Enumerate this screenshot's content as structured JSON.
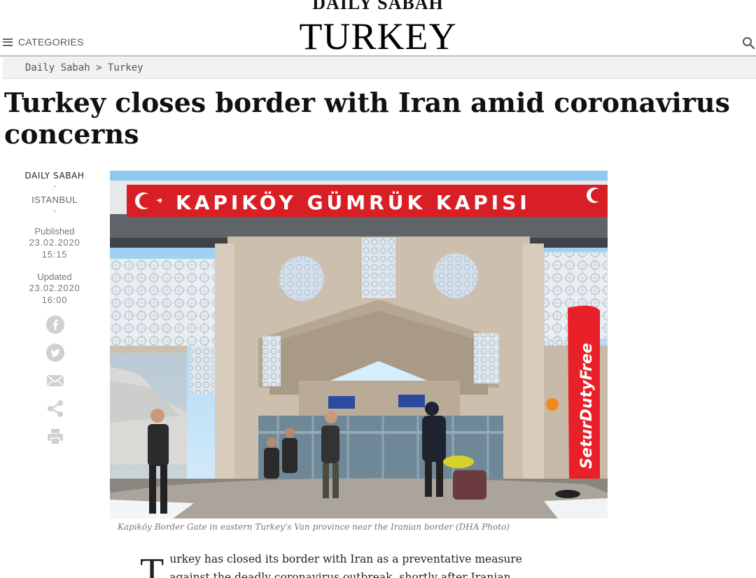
{
  "header": {
    "brand": "DAILY SABAH",
    "section": "TURKEY",
    "menu_label": "CATEGORIES",
    "menu_icon": "hamburger-icon",
    "search_icon": "search-icon"
  },
  "breadcrumb": "Daily Sabah > Turkey",
  "article": {
    "title": "Turkey closes border with Iran amid coronavirus concerns",
    "author": "DAILY SABAH",
    "dot1": "•",
    "location": "ISTANBUL",
    "dot2": "•",
    "published_label": "Published",
    "published_date": "23.02.2020",
    "published_time": "15:15",
    "updated_label": "Updated",
    "updated_date": "23.02.2020",
    "updated_time": "16:00",
    "share_icons": [
      "facebook-icon",
      "twitter-icon",
      "email-icon",
      "share-icon",
      "print-icon"
    ],
    "photo": {
      "sign_text": "KAPIKÖY GÜMRÜK KAPISI",
      "banner_text": "SeturDutyFree"
    },
    "caption": "Kapıköy Border Gate in eastern Turkey's Van province near the Iranian border (DHA Photo)",
    "dropcap": "T",
    "lead_line1": "urkey has closed its border with Iran as a preventative measure",
    "lead_line2": "against the deadly coronavirus outbreak, shortly after Iranian"
  },
  "colors": {
    "sign_red": "#d81f26",
    "banner_red": "#e8202a",
    "sky": "#8ec8ef",
    "stone": "#cdbfae"
  }
}
